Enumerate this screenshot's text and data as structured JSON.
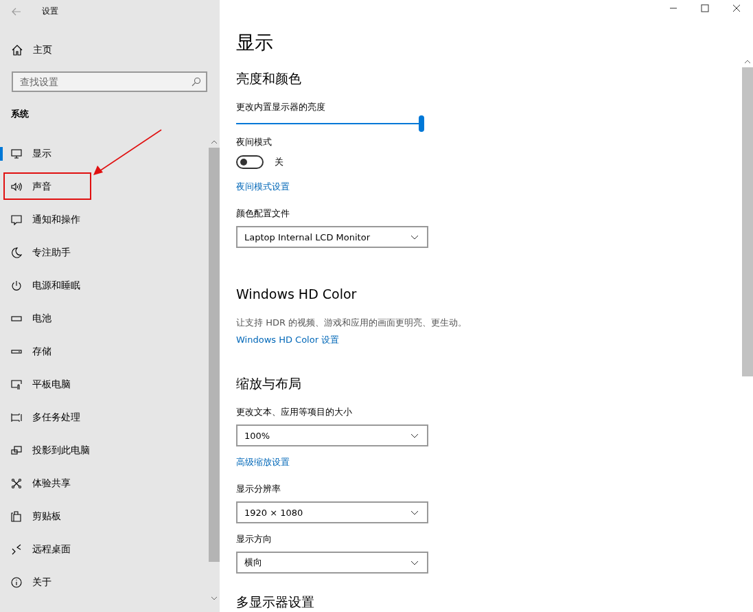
{
  "window": {
    "title": "设置"
  },
  "sidebar": {
    "home": "主页",
    "search": {
      "placeholder": "查找设置"
    },
    "section": "系统",
    "items": [
      {
        "label": "显示",
        "selected": true
      },
      {
        "label": "声音",
        "selected": false
      },
      {
        "label": "通知和操作",
        "selected": false
      },
      {
        "label": "专注助手",
        "selected": false
      },
      {
        "label": "电源和睡眠",
        "selected": false
      },
      {
        "label": "电池",
        "selected": false
      },
      {
        "label": "存储",
        "selected": false
      },
      {
        "label": "平板电脑",
        "selected": false
      },
      {
        "label": "多任务处理",
        "selected": false
      },
      {
        "label": "投影到此电脑",
        "selected": false
      },
      {
        "label": "体验共享",
        "selected": false
      },
      {
        "label": "剪贴板",
        "selected": false
      },
      {
        "label": "远程桌面",
        "selected": false
      },
      {
        "label": "关于",
        "selected": false
      }
    ]
  },
  "content": [
    {
      "kind": "h1",
      "text": "显示"
    },
    {
      "kind": "h2",
      "text": "亮度和颜色"
    },
    {
      "kind": "label",
      "text": "更改内置显示器的亮度"
    },
    {
      "kind": "slider",
      "level": 1
    },
    {
      "kind": "label",
      "text": "夜间模式"
    },
    {
      "kind": "toggle",
      "on": false,
      "text": "关"
    },
    {
      "kind": "link",
      "text": "夜间模式设置"
    },
    {
      "kind": "label",
      "text": "颜色配置文件"
    },
    {
      "kind": "dropdown",
      "text": "Laptop Internal LCD Monitor"
    },
    {
      "kind": "h2",
      "text": "Windows HD Color"
    },
    {
      "kind": "text",
      "text": "让支持 HDR 的视频、游戏和应用的画面更明亮、更生动。"
    },
    {
      "kind": "link",
      "text": "Windows HD Color 设置"
    },
    {
      "kind": "h2",
      "text": "缩放与布局"
    },
    {
      "kind": "label",
      "text": "更改文本、应用等项目的大小"
    },
    {
      "kind": "dropdown",
      "text": "100%"
    },
    {
      "kind": "link",
      "text": "高级缩放设置"
    },
    {
      "kind": "label",
      "text": "显示分辨率"
    },
    {
      "kind": "dropdown",
      "text": "1920 × 1080"
    },
    {
      "kind": "label",
      "text": "显示方向"
    },
    {
      "kind": "dropdown",
      "text": "横向"
    },
    {
      "kind": "h2",
      "text": "多显示器设置"
    }
  ]
}
